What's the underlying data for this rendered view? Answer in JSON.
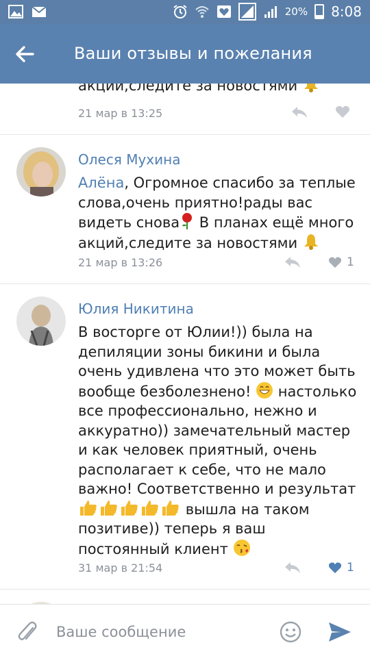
{
  "status_bar": {
    "battery": "20%",
    "time": "8:08"
  },
  "header": {
    "title": "Ваши отзывы и пожелания"
  },
  "comments": [
    {
      "text_tail": "акций,следите за новостями",
      "time": "21 мар в 13:25"
    },
    {
      "author": "Олеся Мухина",
      "mention": "Алёна",
      "text_rest": " Огромное спасибо за теплые слова,очень приятно!рады вас видеть снова",
      "text_after_rose": " В планах ещё много акций,следите за новостями",
      "time": "21 мар в 13:26",
      "likes": "1"
    },
    {
      "author": "Юлия Никитина",
      "text_part1": "В восторге от Юлии!)) была на депиляции зоны бикини и была очень удивлена что это может быть вообще безболезнено!",
      "text_part2": " настолько все профессионально, нежно и аккуратно)) замечательный мастер и как человек приятный, очень располагает к себе, что не мало важно! Соответственно и результат",
      "text_part3": " вышла на таком позитиве)) теперь я ваш постоянный клиент",
      "time": "31 мар в 21:54",
      "likes": "1"
    }
  ],
  "composer": {
    "placeholder": "Ваше сообщение"
  },
  "colors": {
    "header": "#5a82b0",
    "statusbar": "#5b7fa8",
    "link": "#4f7fb3",
    "meta": "#8b9099"
  }
}
